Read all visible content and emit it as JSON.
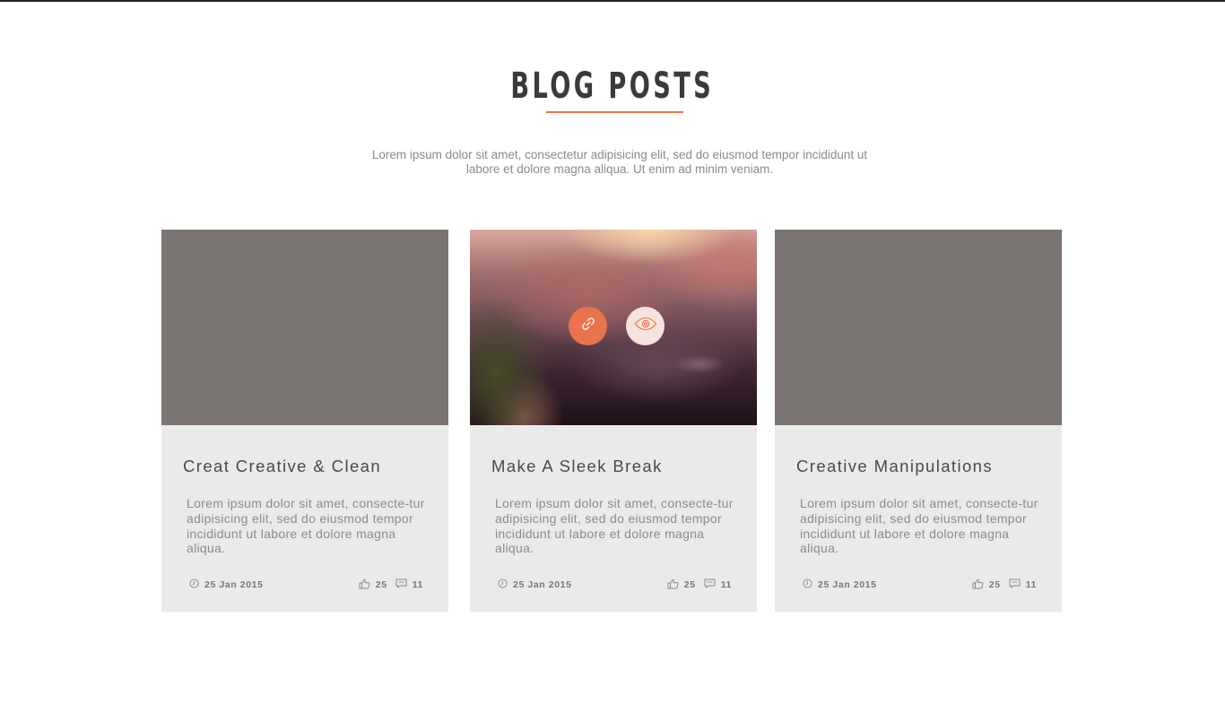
{
  "section": {
    "title": "BLOG POSTS",
    "intro": "Lorem ipsum dolor sit amet, consectetur adipisicing elit, sed do eiusmod tempor incididunt ut labore et dolore magna aliqua. Ut enim ad minim veniam."
  },
  "colors": {
    "accent": "#e8734c",
    "accent_light": "#f7e3dd",
    "title": "#3a3a3a",
    "card_bg": "#eaeaea",
    "media_placeholder": "#7a7573"
  },
  "icons": {
    "date": "clock-icon",
    "likes": "thumbs-up-icon",
    "comments": "comment-icon",
    "link": "link-icon",
    "view": "eye-icon"
  },
  "posts": [
    {
      "title": "Creat Creative & Clean",
      "excerpt": "Lorem ipsum dolor sit amet, consecte-tur adipisicing elit, sed do eiusmod tempor incididunt ut labore et dolore magna aliqua.",
      "date": "25 Jan 2015",
      "likes": "25",
      "comments": "11"
    },
    {
      "title": "Make A Sleek Break",
      "excerpt": "Lorem ipsum dolor sit amet, consecte-tur adipisicing elit, sed do eiusmod tempor incididunt ut labore et dolore magna aliqua.",
      "date": "25 Jan 2015",
      "likes": "25",
      "comments": "11"
    },
    {
      "title": "Creative Manipulations",
      "excerpt": "Lorem ipsum dolor sit amet, consecte-tur adipisicing elit, sed do eiusmod tempor incididunt ut labore et dolore magna aliqua.",
      "date": "25 Jan 2015",
      "likes": "25",
      "comments": "11"
    }
  ]
}
